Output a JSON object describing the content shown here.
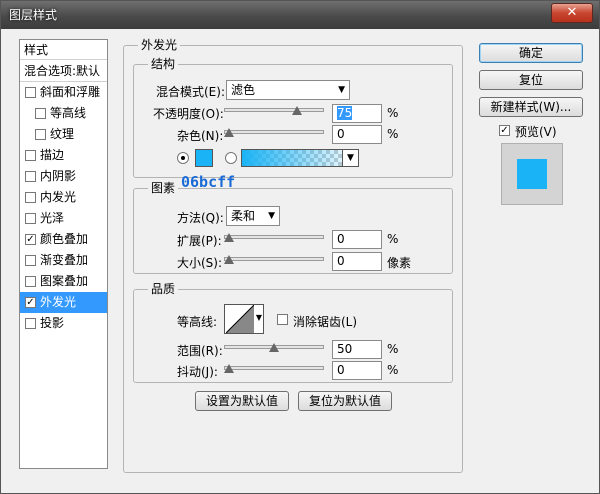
{
  "window": {
    "title": "图层样式",
    "close": "✕"
  },
  "styles": {
    "header": "样式",
    "blend_options": "混合选项:默认",
    "items": [
      {
        "label": "斜面和浮雕",
        "checked": false,
        "sub": false
      },
      {
        "label": "等高线",
        "checked": false,
        "sub": true
      },
      {
        "label": "纹理",
        "checked": false,
        "sub": true
      },
      {
        "label": "描边",
        "checked": false,
        "sub": false
      },
      {
        "label": "内阴影",
        "checked": false,
        "sub": false
      },
      {
        "label": "内发光",
        "checked": false,
        "sub": false
      },
      {
        "label": "光泽",
        "checked": false,
        "sub": false
      },
      {
        "label": "颜色叠加",
        "checked": true,
        "sub": false
      },
      {
        "label": "渐变叠加",
        "checked": false,
        "sub": false
      },
      {
        "label": "图案叠加",
        "checked": false,
        "sub": false
      },
      {
        "label": "外发光",
        "checked": true,
        "sub": false,
        "selected": true
      },
      {
        "label": "投影",
        "checked": false,
        "sub": false
      }
    ]
  },
  "outer_glow": {
    "title": "外发光",
    "structure": {
      "title": "结构",
      "blend_mode_label": "混合模式(E):",
      "blend_mode_value": "滤色",
      "opacity_label": "不透明度(O):",
      "opacity_value": "75",
      "opacity_unit": "%",
      "opacity_fraction": 0.75,
      "noise_label": "杂色(N):",
      "noise_value": "0",
      "noise_unit": "%",
      "noise_fraction": 0.0,
      "color": "#1ab3f5"
    },
    "annotation": "06bcff",
    "elements": {
      "title": "图素",
      "method_label": "方法(Q):",
      "method_value": "柔和",
      "spread_label": "扩展(P):",
      "spread_value": "0",
      "spread_unit": "%",
      "spread_fraction": 0.0,
      "size_label": "大小(S):",
      "size_value": "0",
      "size_unit": "像素",
      "size_fraction": 0.0
    },
    "quality": {
      "title": "品质",
      "contour_label": "等高线:",
      "anti_alias_label": "消除锯齿(L)",
      "anti_alias_checked": false,
      "range_label": "范围(R):",
      "range_value": "50",
      "range_unit": "%",
      "range_fraction": 0.5,
      "jitter_label": "抖动(J):",
      "jitter_value": "0",
      "jitter_unit": "%",
      "jitter_fraction": 0.0
    },
    "make_default": "设置为默认值",
    "reset_default": "复位为默认值"
  },
  "actions": {
    "ok": "确定",
    "reset": "复位",
    "new_style": "新建样式(W)...",
    "preview_label": "预览(V)",
    "preview_checked": true,
    "preview_color": "#1ab3f5"
  }
}
